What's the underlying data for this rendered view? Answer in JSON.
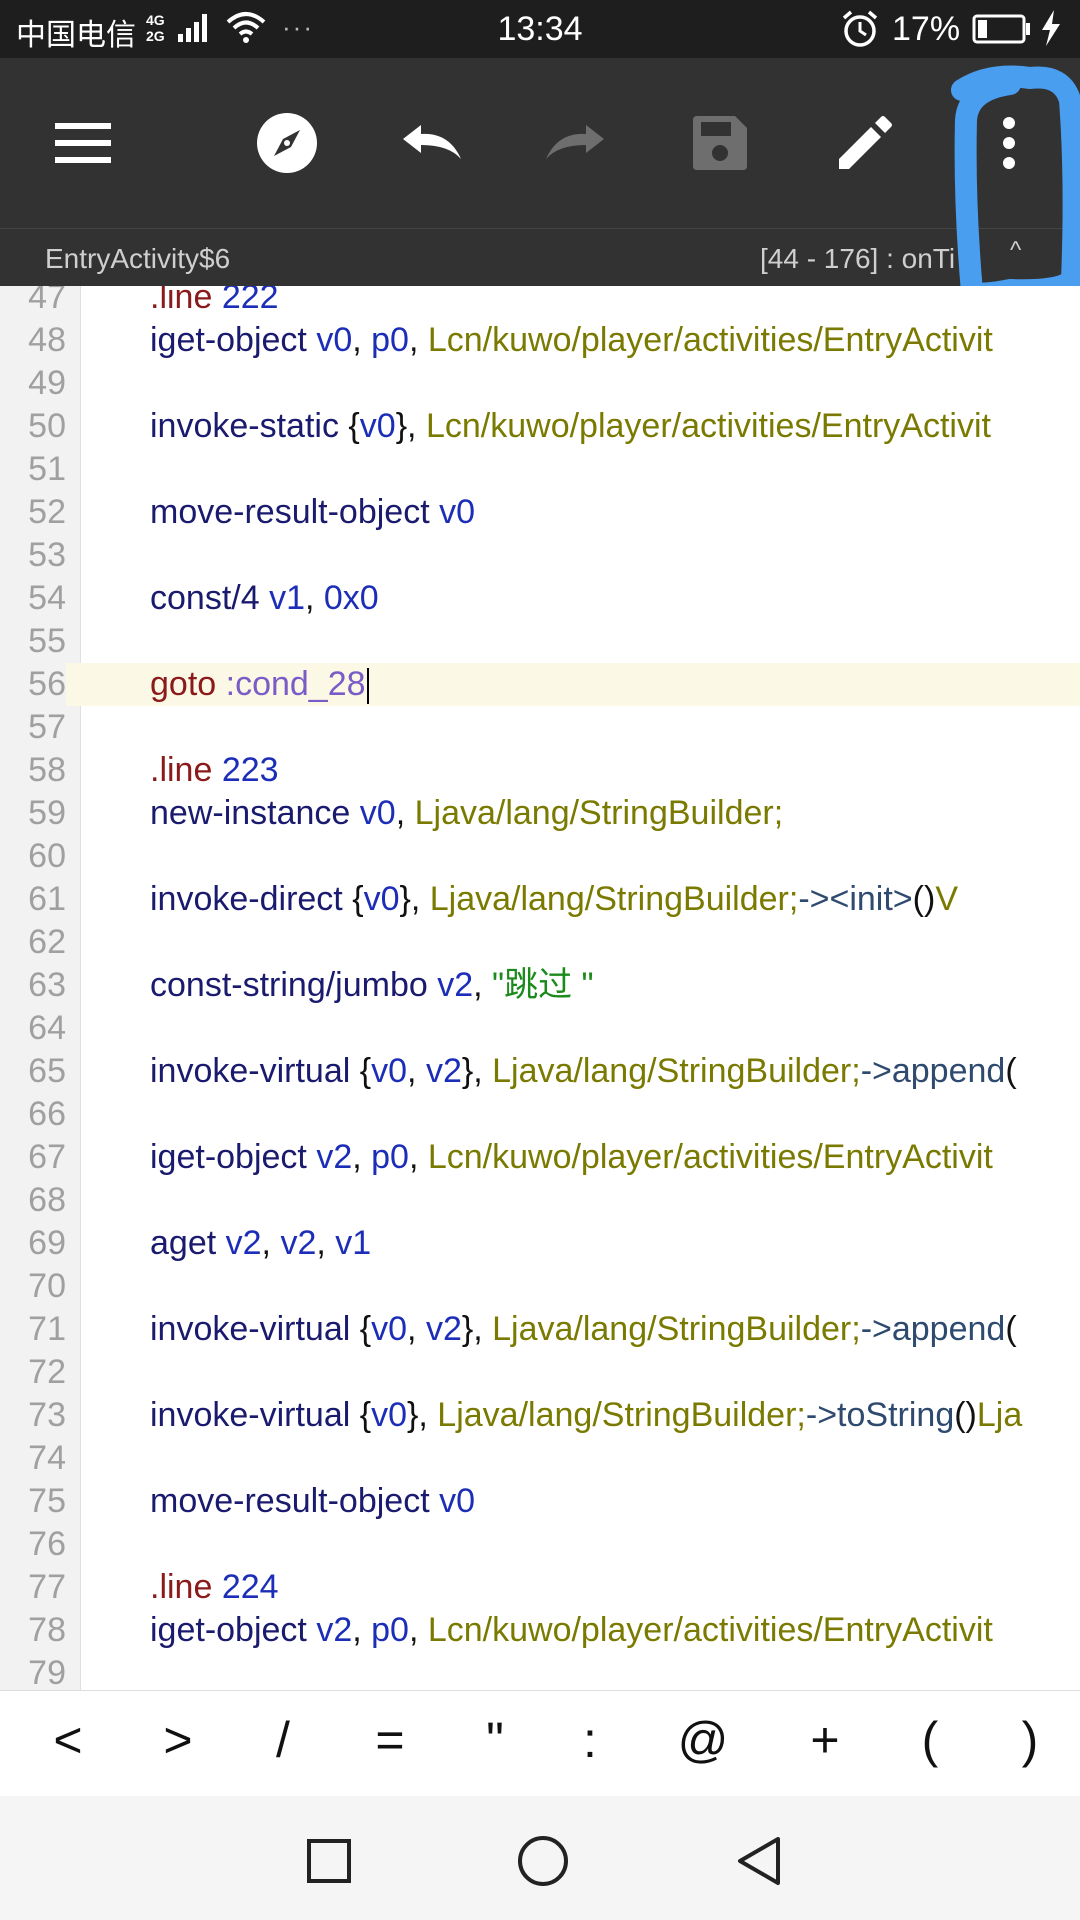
{
  "status_bar": {
    "carrier": "中国电信",
    "net_top": "4G",
    "net_bottom": "2G",
    "time": "13:34",
    "battery_percent": "17%",
    "dots": "···"
  },
  "toolbar": {
    "icons": [
      "menu-icon",
      "compass-icon",
      "undo-icon",
      "redo-icon",
      "save-icon",
      "edit-icon",
      "more-vert-icon"
    ]
  },
  "subheader": {
    "class_name": "EntryActivity$6",
    "method_range": "[44 - 176] : onTi",
    "caret": "^"
  },
  "editor": {
    "lines": [
      {
        "n": "47",
        "tokens": [
          {
            "t": ".line",
            "c": "dir"
          },
          {
            "t": " 222",
            "c": "num"
          }
        ]
      },
      {
        "n": "48",
        "tokens": [
          {
            "t": "iget-object",
            "c": "op"
          },
          {
            "t": " v0",
            "c": "reg"
          },
          {
            "t": ",",
            "c": "pun"
          },
          {
            "t": " p0",
            "c": "reg"
          },
          {
            "t": ",",
            "c": "pun"
          },
          {
            "t": " Lcn/kuwo/player/activities/EntryActivit",
            "c": "typ"
          }
        ]
      },
      {
        "n": "49",
        "tokens": []
      },
      {
        "n": "50",
        "tokens": [
          {
            "t": "invoke-static",
            "c": "op"
          },
          {
            "t": " {",
            "c": "pun"
          },
          {
            "t": "v0",
            "c": "reg"
          },
          {
            "t": "},",
            "c": "pun"
          },
          {
            "t": " Lcn/kuwo/player/activities/EntryActivit",
            "c": "typ"
          }
        ]
      },
      {
        "n": "51",
        "tokens": []
      },
      {
        "n": "52",
        "tokens": [
          {
            "t": "move-result-object",
            "c": "op"
          },
          {
            "t": " v0",
            "c": "reg"
          }
        ]
      },
      {
        "n": "53",
        "tokens": []
      },
      {
        "n": "54",
        "tokens": [
          {
            "t": "const/4",
            "c": "op"
          },
          {
            "t": " v1",
            "c": "reg"
          },
          {
            "t": ",",
            "c": "pun"
          },
          {
            "t": " 0x0",
            "c": "num"
          }
        ]
      },
      {
        "n": "55",
        "tokens": []
      },
      {
        "n": "56",
        "highlight": true,
        "cursor": true,
        "tokens": [
          {
            "t": "goto",
            "c": "dir"
          },
          {
            "t": " :cond_28",
            "c": "lbl"
          }
        ]
      },
      {
        "n": "57",
        "tokens": []
      },
      {
        "n": "58",
        "tokens": [
          {
            "t": ".line",
            "c": "dir"
          },
          {
            "t": " 223",
            "c": "num"
          }
        ]
      },
      {
        "n": "59",
        "tokens": [
          {
            "t": "new-instance",
            "c": "op"
          },
          {
            "t": " v0",
            "c": "reg"
          },
          {
            "t": ",",
            "c": "pun"
          },
          {
            "t": " Ljava/lang/StringBuilder;",
            "c": "typ"
          }
        ]
      },
      {
        "n": "60",
        "tokens": []
      },
      {
        "n": "61",
        "tokens": [
          {
            "t": "invoke-direct",
            "c": "op"
          },
          {
            "t": " {",
            "c": "pun"
          },
          {
            "t": "v0",
            "c": "reg"
          },
          {
            "t": "},",
            "c": "pun"
          },
          {
            "t": " Ljava/lang/StringBuilder;",
            "c": "typ"
          },
          {
            "t": "-><init>",
            "c": "meth"
          },
          {
            "t": "()",
            "c": "pun"
          },
          {
            "t": "V",
            "c": "typ"
          }
        ]
      },
      {
        "n": "62",
        "tokens": []
      },
      {
        "n": "63",
        "tokens": [
          {
            "t": "const-string/jumbo",
            "c": "op"
          },
          {
            "t": " v2",
            "c": "reg"
          },
          {
            "t": ",",
            "c": "pun"
          },
          {
            "t": " \"跳过 \"",
            "c": "str"
          }
        ]
      },
      {
        "n": "64",
        "tokens": []
      },
      {
        "n": "65",
        "tokens": [
          {
            "t": "invoke-virtual",
            "c": "op"
          },
          {
            "t": " {",
            "c": "pun"
          },
          {
            "t": "v0",
            "c": "reg"
          },
          {
            "t": ",",
            "c": "pun"
          },
          {
            "t": " v2",
            "c": "reg"
          },
          {
            "t": "},",
            "c": "pun"
          },
          {
            "t": " Ljava/lang/StringBuilder;",
            "c": "typ"
          },
          {
            "t": "->append",
            "c": "meth"
          },
          {
            "t": "(",
            "c": "pun"
          }
        ]
      },
      {
        "n": "66",
        "tokens": []
      },
      {
        "n": "67",
        "tokens": [
          {
            "t": "iget-object",
            "c": "op"
          },
          {
            "t": " v2",
            "c": "reg"
          },
          {
            "t": ",",
            "c": "pun"
          },
          {
            "t": " p0",
            "c": "reg"
          },
          {
            "t": ",",
            "c": "pun"
          },
          {
            "t": " Lcn/kuwo/player/activities/EntryActivit",
            "c": "typ"
          }
        ]
      },
      {
        "n": "68",
        "tokens": []
      },
      {
        "n": "69",
        "tokens": [
          {
            "t": "aget",
            "c": "op"
          },
          {
            "t": " v2",
            "c": "reg"
          },
          {
            "t": ",",
            "c": "pun"
          },
          {
            "t": " v2",
            "c": "reg"
          },
          {
            "t": ",",
            "c": "pun"
          },
          {
            "t": " v1",
            "c": "reg"
          }
        ]
      },
      {
        "n": "70",
        "tokens": []
      },
      {
        "n": "71",
        "tokens": [
          {
            "t": "invoke-virtual",
            "c": "op"
          },
          {
            "t": " {",
            "c": "pun"
          },
          {
            "t": "v0",
            "c": "reg"
          },
          {
            "t": ",",
            "c": "pun"
          },
          {
            "t": " v2",
            "c": "reg"
          },
          {
            "t": "},",
            "c": "pun"
          },
          {
            "t": " Ljava/lang/StringBuilder;",
            "c": "typ"
          },
          {
            "t": "->append",
            "c": "meth"
          },
          {
            "t": "(",
            "c": "pun"
          }
        ]
      },
      {
        "n": "72",
        "tokens": []
      },
      {
        "n": "73",
        "tokens": [
          {
            "t": "invoke-virtual",
            "c": "op"
          },
          {
            "t": " {",
            "c": "pun"
          },
          {
            "t": "v0",
            "c": "reg"
          },
          {
            "t": "},",
            "c": "pun"
          },
          {
            "t": " Ljava/lang/StringBuilder;",
            "c": "typ"
          },
          {
            "t": "->toString",
            "c": "meth"
          },
          {
            "t": "()",
            "c": "pun"
          },
          {
            "t": "Lja",
            "c": "typ"
          }
        ]
      },
      {
        "n": "74",
        "tokens": []
      },
      {
        "n": "75",
        "tokens": [
          {
            "t": "move-result-object",
            "c": "op"
          },
          {
            "t": " v0",
            "c": "reg"
          }
        ]
      },
      {
        "n": "76",
        "tokens": []
      },
      {
        "n": "77",
        "tokens": [
          {
            "t": ".line",
            "c": "dir"
          },
          {
            "t": " 224",
            "c": "num"
          }
        ]
      },
      {
        "n": "78",
        "tokens": [
          {
            "t": "iget-object",
            "c": "op"
          },
          {
            "t": " v2",
            "c": "reg"
          },
          {
            "t": ",",
            "c": "pun"
          },
          {
            "t": " p0",
            "c": "reg"
          },
          {
            "t": ",",
            "c": "pun"
          },
          {
            "t": " Lcn/kuwo/player/activities/EntryActivit",
            "c": "typ"
          }
        ]
      },
      {
        "n": "79",
        "tokens": []
      }
    ]
  },
  "symbols": [
    "<",
    ">",
    "/",
    "=",
    "\"",
    ":",
    "@",
    "+",
    "(",
    ")"
  ],
  "nav": {
    "icons": [
      "recent-apps-icon",
      "home-icon",
      "back-icon"
    ]
  },
  "colors": {
    "toolbar_bg": "#323232",
    "annotation": "#4a9ef0"
  }
}
